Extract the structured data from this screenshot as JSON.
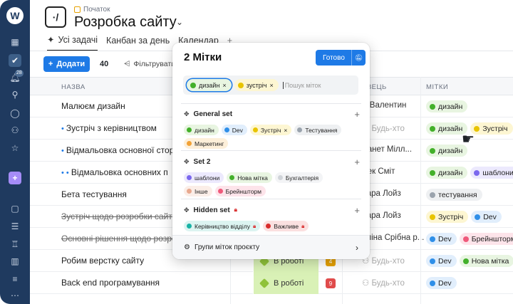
{
  "sidebar": {
    "logo": "W",
    "badge": "28",
    "icons": [
      "grid-icon",
      "check-icon",
      "bell-icon",
      "search-icon",
      "chat-icon",
      "users-icon",
      "star-icon",
      "plus-icon",
      "briefcase-icon",
      "stack-icon",
      "trophy-icon",
      "chart-icon",
      "layers-icon",
      "more-icon"
    ]
  },
  "header": {
    "breadcrumb": "Початок",
    "title": "Розробка сайту",
    "tabs": [
      {
        "label": "Усі задачі"
      },
      {
        "label": "Канбан за день"
      },
      {
        "label": "Календар"
      }
    ],
    "tab_add": "+"
  },
  "toolbar": {
    "add_label": "Додати",
    "count": "40",
    "filter_label": "Фільтрувати"
  },
  "table": {
    "col_name": "НАЗВА",
    "col_assignee": "АВЕЦЬ",
    "col_tags": "МІТКИ",
    "rows": [
      {
        "name": "Малюєм дизайн",
        "prefix": "",
        "person": "ік Валентин",
        "tags": [
          {
            "label": "дизайн",
            "color": "#43b02a",
            "bg": "#e8f5e1"
          }
        ]
      },
      {
        "name": "Зустріч з керівництвом",
        "prefix": "•",
        "person": "Будь-хто",
        "empty": true,
        "tags": [
          {
            "label": "дизайн",
            "color": "#43b02a",
            "bg": "#e8f5e1"
          },
          {
            "label": "Зустріч",
            "color": "#e8c400",
            "bg": "#fdf6d2"
          }
        ]
      },
      {
        "name": "Відмальовка основної стор",
        "prefix": "•",
        "person": "жанет Мілл...",
        "tags": [
          {
            "label": "дизайн",
            "color": "#43b02a",
            "bg": "#e8f5e1"
          }
        ]
      },
      {
        "name": "Відмальовка основних п",
        "prefix": "• •",
        "person": "жек Сміт",
        "tags": [
          {
            "label": "дизайн",
            "color": "#43b02a",
            "bg": "#e8f5e1"
          },
          {
            "label": "шаблони",
            "color": "#7b68ee",
            "bg": "#ece9fd"
          }
        ]
      },
      {
        "name": "Бета тестування",
        "prefix": "",
        "person": "лара Лойз",
        "tags": [
          {
            "label": "тестування",
            "color": "#9aa3ad",
            "bg": "#eef0f2"
          }
        ]
      },
      {
        "name": "Зустріч щодо розробки сайту",
        "prefix": "",
        "done": true,
        "person": "лара Лойз",
        "tags": [
          {
            "label": "Зустріч",
            "color": "#e8c400",
            "bg": "#fdf6d2"
          },
          {
            "label": "Dev",
            "color": "#2f8fe8",
            "bg": "#e1eefc"
          }
        ]
      },
      {
        "name": "Основні рішення щодо розробки",
        "prefix": "",
        "done": true,
        "person": "аліна Срібна р...",
        "tags": [
          {
            "label": "Dev",
            "color": "#2f8fe8",
            "bg": "#e1eefc"
          },
          {
            "label": "Брейншторм",
            "color": "#ef5a7b",
            "bg": "#fde4ea"
          }
        ]
      },
      {
        "name": "Робим верстку сайту",
        "prefix": "",
        "person": "Будь-хто",
        "empty": true,
        "status": "В роботі",
        "prio": "4",
        "prio_color": "#e6a100",
        "tags": [
          {
            "label": "Dev",
            "color": "#2f8fe8",
            "bg": "#e1eefc"
          },
          {
            "label": "Нова мітка",
            "color": "#43b02a",
            "bg": "#e8f5e1"
          }
        ]
      },
      {
        "name": "Back end програмування",
        "prefix": "",
        "person": "Будь-хто",
        "empty": true,
        "status": "В роботі",
        "prio": "9",
        "prio_color": "#e04b4b",
        "tags": [
          {
            "label": "Dev",
            "color": "#2f8fe8",
            "bg": "#e1eefc"
          }
        ]
      }
    ]
  },
  "popup": {
    "title": "2 Мітки",
    "done_label": "Готово",
    "search_placeholder": "Пошук міток",
    "selected": [
      {
        "label": "дизайн",
        "color": "#43b02a",
        "bg": "#e8f5e1",
        "sel": true
      },
      {
        "label": "зустріч",
        "color": "#e8c400",
        "bg": "#fdf6d2"
      }
    ],
    "groups": [
      {
        "name": "General set",
        "locked": false,
        "tags": [
          {
            "label": "дизайн",
            "color": "#43b02a",
            "bg": "#e8f5e1"
          },
          {
            "label": "Dev",
            "color": "#2f8fe8",
            "bg": "#e1eefc"
          },
          {
            "label": "Зустріч",
            "color": "#e8c400",
            "bg": "#fdf6d2",
            "x": true
          },
          {
            "label": "Тестування",
            "color": "#9aa3ad",
            "bg": "#eef0f2"
          },
          {
            "label": "Маркетинг",
            "color": "#f2a236",
            "bg": "#fdefd9"
          }
        ]
      },
      {
        "name": "Set 2",
        "locked": false,
        "tags": [
          {
            "label": "шаблони",
            "color": "#7b68ee",
            "bg": "#ece9fd"
          },
          {
            "label": "Нова мітка",
            "color": "#43b02a",
            "bg": "#e8f5e1"
          },
          {
            "label": "Бухгалтерія",
            "color": "#d0d4d9",
            "bg": "#f3f4f6"
          },
          {
            "label": "Інше",
            "color": "#e8a98f",
            "bg": "#fbeee8"
          },
          {
            "label": "Брейншторм",
            "color": "#ef5a7b",
            "bg": "#fde4ea"
          }
        ]
      },
      {
        "name": "Hidden set",
        "locked": true,
        "tags": [
          {
            "label": "Керівництво відділу",
            "color": "#19b3a6",
            "bg": "#dcf4f1",
            "lock": true
          },
          {
            "label": "Важливе",
            "color": "#d92d2d",
            "bg": "#fbe0e0",
            "lock": true
          }
        ]
      }
    ],
    "footer_label": "Групи міток проєкту"
  }
}
